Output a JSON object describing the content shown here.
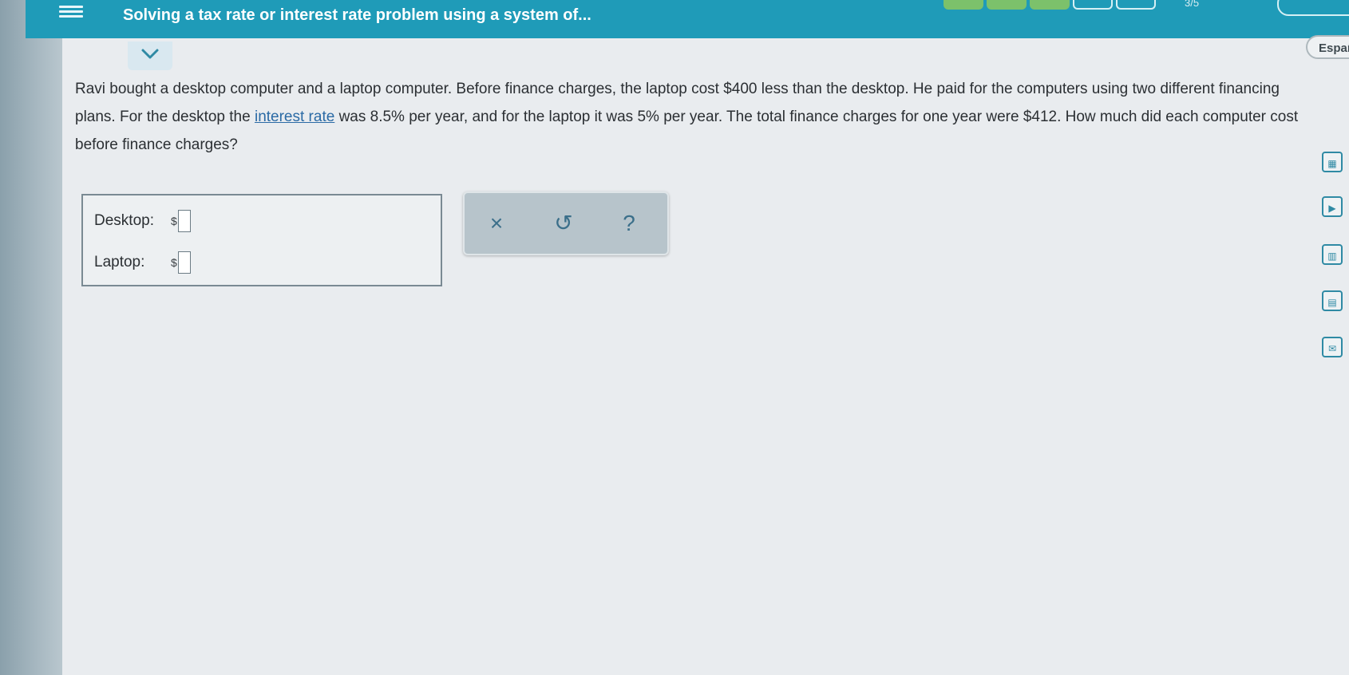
{
  "header": {
    "title": "Solving a tax rate or interest rate problem using a system of...",
    "progress_label": "3/5",
    "progress_completed": 3,
    "progress_total": 5
  },
  "language_button": "Españo",
  "problem": {
    "part1": "Ravi bought a desktop computer and a laptop computer. Before finance charges, the laptop cost $400 less than the desktop. He paid for the computers using two different financing plans. For the desktop the ",
    "link_text": "interest rate",
    "part2": " was 8.5% per year, and for the laptop it was 5% per year. The total finance charges for one year were $412. How much did each computer cost before finance charges?"
  },
  "answers": {
    "desktop_label": "Desktop:",
    "laptop_label": "Laptop:",
    "currency_symbol": "$",
    "desktop_value": "",
    "laptop_value": ""
  },
  "tools": {
    "clear_symbol": "×",
    "undo_symbol": "↺",
    "help_symbol": "?"
  },
  "side_icons": [
    "calculator-icon",
    "video-icon",
    "textbook-icon",
    "glossary-icon",
    "message-icon"
  ],
  "colors": {
    "header": "#1f9bb8",
    "progress_done": "#7cc16b",
    "link": "#2a6aa5",
    "tool_icon": "#3b6f8a"
  }
}
